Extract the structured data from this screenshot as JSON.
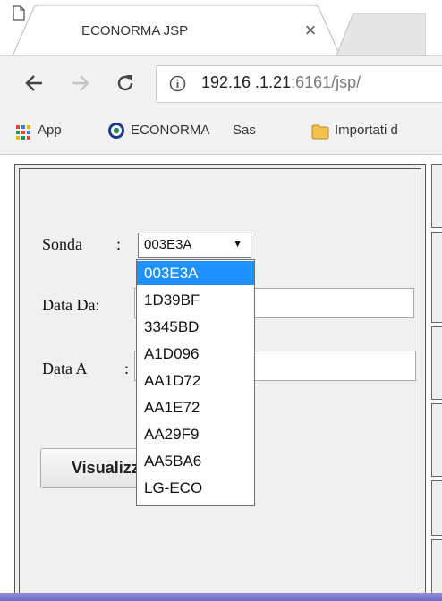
{
  "tab": {
    "title": "ECONORMA JSP",
    "close": "×"
  },
  "address": {
    "url_host": "192.16 .1.21",
    "url_port": ":6161",
    "url_path": "/jsp/"
  },
  "bookmarks": [
    {
      "label": "App"
    },
    {
      "label": "ECONORMA"
    },
    {
      "label": "Sas"
    },
    {
      "label": "Importati d"
    }
  ],
  "form": {
    "sonda_label": "Sonda",
    "sonda_colon": ":",
    "sonda_selected": "003E3A",
    "data_da_label": "Data Da:",
    "data_da_value": "",
    "data_a_label": "Data A",
    "data_a_colon": ":",
    "data_a_value": "",
    "button_label": "Visualizza"
  },
  "dropdown": {
    "options": [
      "003E3A",
      "1D39BF",
      "3345BD",
      "A1D096",
      "AA1D72",
      "AA1E72",
      "AA29F9",
      "AA5BA6",
      "LG-ECO"
    ],
    "highlighted": 0
  },
  "colors": {
    "highlight": "#1e90ff",
    "folder": "#f2c14e",
    "accent_band": "#7a76cf"
  }
}
